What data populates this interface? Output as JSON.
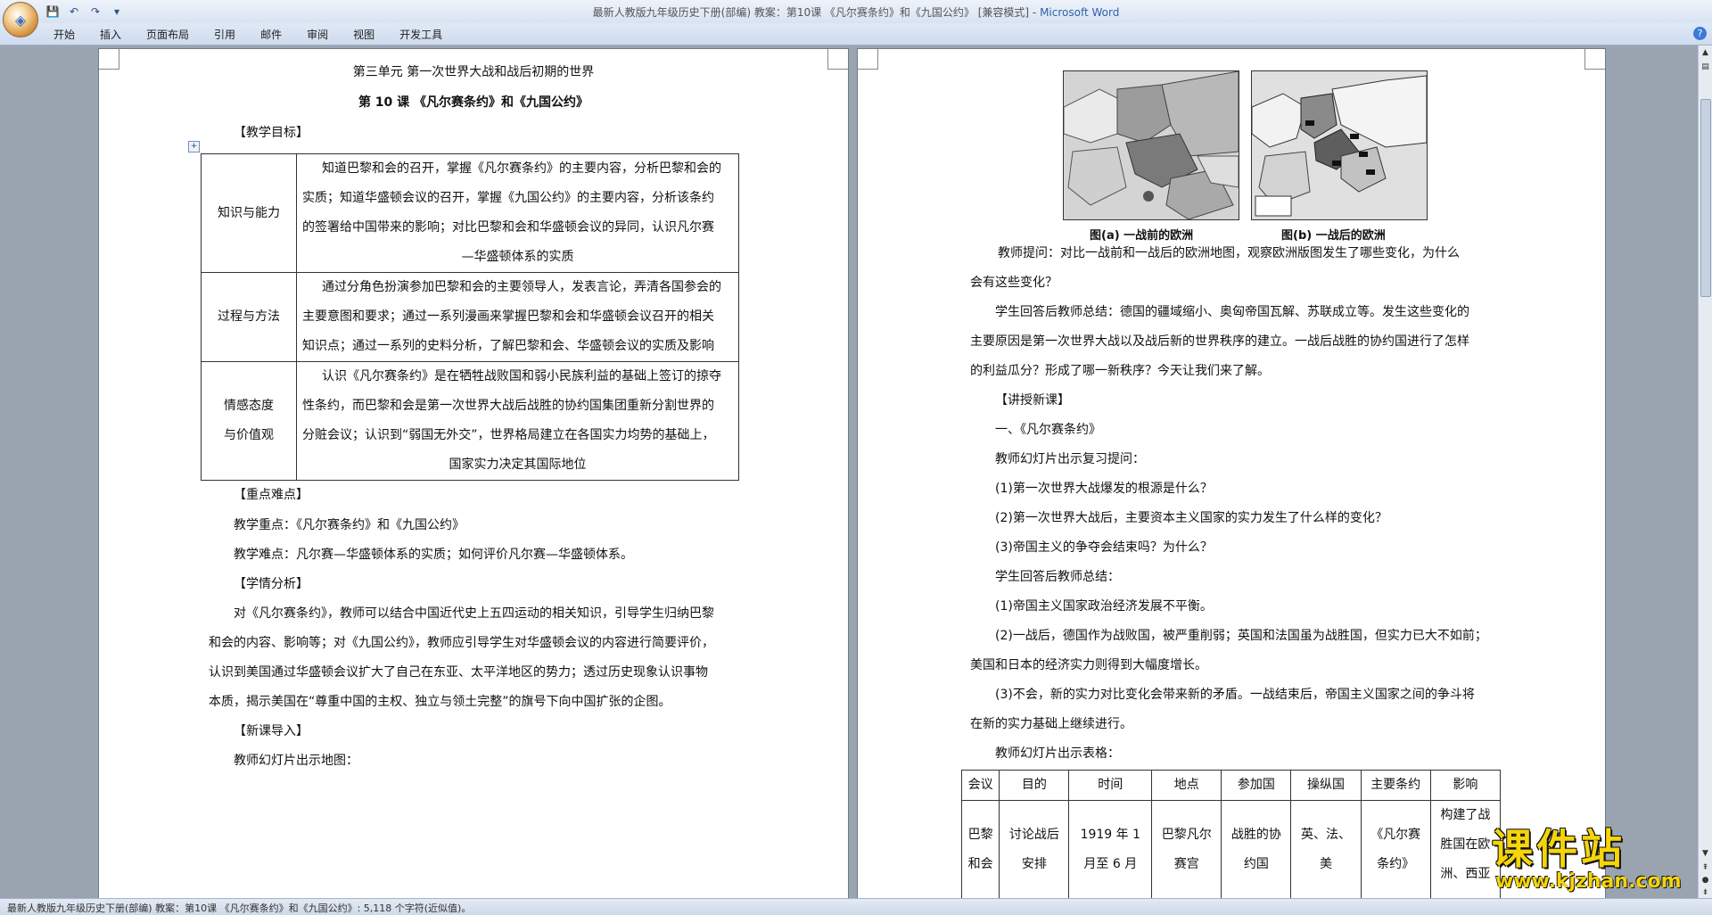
{
  "window": {
    "title_prefix": "最新人教版九年级历史下册(部编) 教案：第10课 《凡尔赛条约》和《九国公约》 [兼容模式] - ",
    "app_name": "Microsoft Word"
  },
  "ribbon": {
    "tabs": [
      "开始",
      "插入",
      "页面布局",
      "引用",
      "邮件",
      "审阅",
      "视图",
      "开发工具"
    ]
  },
  "doc_left": {
    "unit_title": "第三单元 第一次世界大战和战后初期的世界",
    "lesson_title": "第 10 课 《凡尔赛条约》和《九国公约》",
    "goal_heading": "【教学目标】",
    "goals": [
      {
        "label_lines": [
          "知识与能力"
        ],
        "lines": [
          "知道巴黎和会的召开，掌握《凡尔赛条约》的主要内容，分析巴黎和会的",
          "实质；知道华盛顿会议的召开，掌握《九国公约》的主要内容，分析该条约",
          "的签署给中国带来的影响；对比巴黎和会和华盛顿会议的异同，认识凡尔赛",
          "—华盛顿体系的实质"
        ]
      },
      {
        "label_lines": [
          "过程与方法"
        ],
        "lines": [
          "通过分角色扮演参加巴黎和会的主要领导人，发表言论，弄清各国参会的",
          "主要意图和要求；通过一系列漫画来掌握巴黎和会和华盛顿会议召开的相关",
          "知识点；通过一系列的史料分析，了解巴黎和会、华盛顿会议的实质及影响"
        ]
      },
      {
        "label_lines": [
          "情感态度",
          "与价值观"
        ],
        "lines": [
          "认识《凡尔赛条约》是在牺牲战败国和弱小民族利益的基础上签订的掠夺",
          "性条约，而巴黎和会是第一次世界大战后战胜的协约国集团重新分割世界的",
          "分赃会议；认识到“弱国无外交”，世界格局建立在各国实力均势的基础上，",
          "国家实力决定其国际地位"
        ]
      }
    ],
    "key_heading": "【重点难点】",
    "key_point": "教学重点：《凡尔赛条约》和《九国公约》",
    "difficulty": "教学难点：凡尔赛—华盛顿体系的实质；如何评价凡尔赛—华盛顿体系。",
    "analysis_heading": "【学情分析】",
    "analysis_lines": [
      "对《凡尔赛条约》，教师可以结合中国近代史上五四运动的相关知识，引导学生归纳巴黎",
      "和会的内容、影响等；对《九国公约》，教师应引导学生对华盛顿会议的内容进行简要评价，",
      "认识到美国通过华盛顿会议扩大了自己在东亚、太平洋地区的势力；透过历史现象认识事物",
      "本质，揭示美国在“尊重中国的主权、独立与领土完整”的旗号下向中国扩张的企图。"
    ],
    "intro_heading": "【新课导入】",
    "intro_text": "教师幻灯片出示地图："
  },
  "doc_right": {
    "map_a_caption": "图(a) 一战前的欧洲",
    "map_b_caption": "图(b) 一战后的欧洲",
    "question_lines": [
      "教师提问：对比一战前和一战后的欧洲地图，观察欧洲版图发生了哪些变化，为什么",
      "会有这些变化？"
    ],
    "summary_lines": [
      "学生回答后教师总结：德国的疆域缩小、奥匈帝国瓦解、苏联成立等。发生这些变化的",
      "主要原因是第一次世界大战以及战后新的世界秩序的建立。一战后战胜的协约国进行了怎样",
      "的利益瓜分？形成了哪一新秩序？今天让我们来了解。"
    ],
    "lecture_heading": "【讲授新课】",
    "section1": "一、《凡尔赛条约》",
    "review_intro": "教师幻灯片出示复习提问：",
    "review_q": [
      "(1)第一次世界大战爆发的根源是什么？",
      "(2)第一次世界大战后，主要资本主义国家的实力发生了什么样的变化？",
      "(3)帝国主义的争夺会结束吗？为什么？"
    ],
    "answer_intro": "学生回答后教师总结：",
    "answers": [
      "(1)帝国主义国家政治经济发展不平衡。",
      "(2)一战后，德国作为战败国，被严重削弱；英国和法国虽为战胜国，但实力已大不如前；",
      "美国和日本的经济实力则得到大幅度增长。",
      "(3)不会，新的实力对比变化会带来新的矛盾。一战结束后，帝国主义国家之间的争斗将",
      "在新的实力基础上继续进行。"
    ],
    "table_intro": "教师幻灯片出示表格：",
    "table_headers": [
      "会议",
      "目的",
      "时间",
      "地点",
      "参加国",
      "操纵国",
      "主要条约",
      "影响"
    ],
    "table_row": [
      [
        "巴黎",
        "和会"
      ],
      [
        "讨论战后",
        "安排"
      ],
      [
        "1919 年 1",
        "月至 6 月"
      ],
      [
        "巴黎凡尔",
        "赛宫"
      ],
      [
        "战胜的协",
        "约国"
      ],
      [
        "英、法、",
        "美"
      ],
      [
        "《凡尔赛",
        "条约》"
      ],
      [
        "构建了战",
        "胜国在欧",
        "洲、西亚"
      ]
    ]
  },
  "status": {
    "text": "最新人教版九年级历史下册(部编) 教案：第10课 《凡尔赛条约》和《九国公约》: 5,118 个字符(近似值)。"
  },
  "watermark": {
    "main": "课件站",
    "url": "www.kjzhan.com"
  }
}
